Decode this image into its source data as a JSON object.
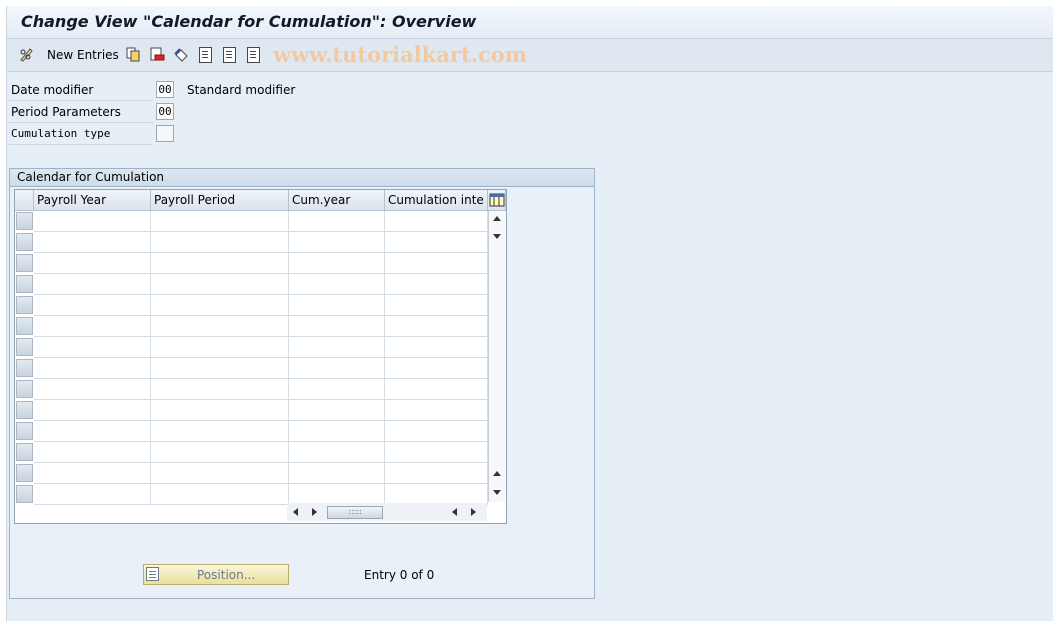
{
  "window": {
    "title": "Change View \"Calendar for Cumulation\": Overview"
  },
  "toolbar": {
    "new_entries_label": "New Entries",
    "watermark": "www.tutorialkart.com",
    "icons": [
      "pencil-glasses-icon",
      "copy-icon",
      "delete-icon",
      "undo-icon",
      "select-all-icon",
      "select-block-icon",
      "deselect-all-icon"
    ]
  },
  "fields": [
    {
      "label": "Date modifier",
      "value": "00",
      "description": "Standard modifier"
    },
    {
      "label": "Period Parameters",
      "value": "00",
      "description": ""
    },
    {
      "label": "Cumulation type",
      "value": "",
      "description": ""
    }
  ],
  "group": {
    "title": "Calendar for Cumulation",
    "columns": [
      "Payroll Year",
      "Payroll Period",
      "Cum.year",
      "Cumulation inte"
    ],
    "row_count": 14
  },
  "footer": {
    "position_button": "Position...",
    "entry_text": "Entry 0 of 0"
  }
}
